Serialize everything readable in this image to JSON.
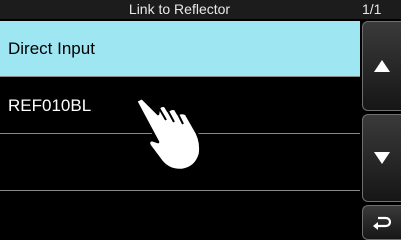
{
  "header": {
    "title": "Link to Reflector",
    "page": "1/1"
  },
  "list": {
    "items": [
      {
        "label": "Direct Input",
        "selected": true
      },
      {
        "label": "REF010BL",
        "selected": false
      },
      {
        "label": "",
        "selected": false
      },
      {
        "label": "",
        "selected": false
      }
    ]
  },
  "side_buttons": {
    "up_icon": "up-triangle-icon",
    "down_icon": "down-triangle-icon",
    "back_icon": "return-arrow-icon"
  },
  "colors": {
    "selected_row": "#9ee6f2",
    "background": "#000000",
    "header": "#1c1c1c"
  }
}
